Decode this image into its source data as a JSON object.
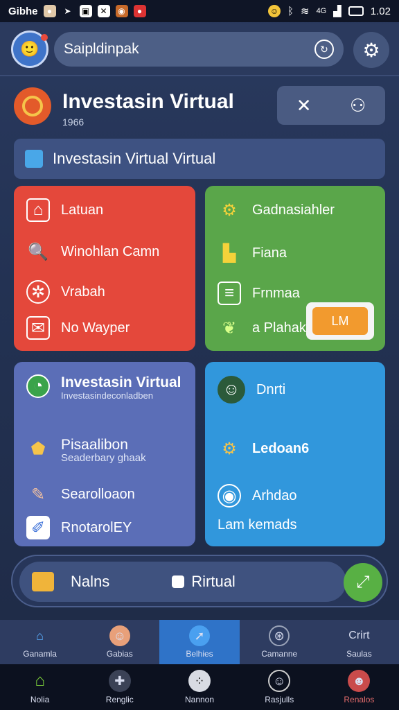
{
  "status_bar": {
    "left_text": "Gibhe",
    "time": "1.02",
    "signal_text": "4G"
  },
  "top_bar": {
    "search_text": "Saipldinpak"
  },
  "header": {
    "title": "Investasin Virtual",
    "subtitle": "1966"
  },
  "banner": {
    "text": "Investasin Virtual Virtual"
  },
  "red_card": {
    "items": [
      {
        "label": "Latuan"
      },
      {
        "label": "Winohlan Camn"
      },
      {
        "label": "Vrabah"
      },
      {
        "label": "No Wayper"
      }
    ]
  },
  "green_card": {
    "items": [
      {
        "label": "Gadnasiahler"
      },
      {
        "label": "Fiana"
      },
      {
        "label": "Frnmaa"
      },
      {
        "label": "a Plahak"
      }
    ],
    "button_label": "LM"
  },
  "purple_card": {
    "title": "Investasin Virtual",
    "title_sub": "Investasindeconladben",
    "items": [
      {
        "label": "Pisaalibon",
        "sub": "Seaderbary ghaak"
      },
      {
        "label": "Searolloaon"
      },
      {
        "label": "RnotarolEY"
      }
    ]
  },
  "blue_card": {
    "items": [
      {
        "label": "Dnrti"
      },
      {
        "label": "Ledoan6"
      },
      {
        "label": "Arhdao"
      },
      {
        "label": "Lam kemads"
      }
    ]
  },
  "floating_bar": {
    "left_label": "Nalns",
    "right_label": "Rirtual"
  },
  "tabs_top": [
    {
      "label": "Ganamla"
    },
    {
      "label": "Gabias"
    },
    {
      "label": "Belhies"
    },
    {
      "label": "Camanne"
    },
    {
      "label": "Saulas",
      "icon_text": "Crirt"
    }
  ],
  "tabs_bottom": [
    {
      "label": "Nolia"
    },
    {
      "label": "Renglic"
    },
    {
      "label": "Nannon"
    },
    {
      "label": "Rasjulls"
    },
    {
      "label": "Renalos"
    }
  ],
  "colors": {
    "red": "#e4483b",
    "green": "#5aa64a",
    "purple": "#5b6eb7",
    "blue": "#3197dc",
    "accent": "#2f73c8"
  }
}
